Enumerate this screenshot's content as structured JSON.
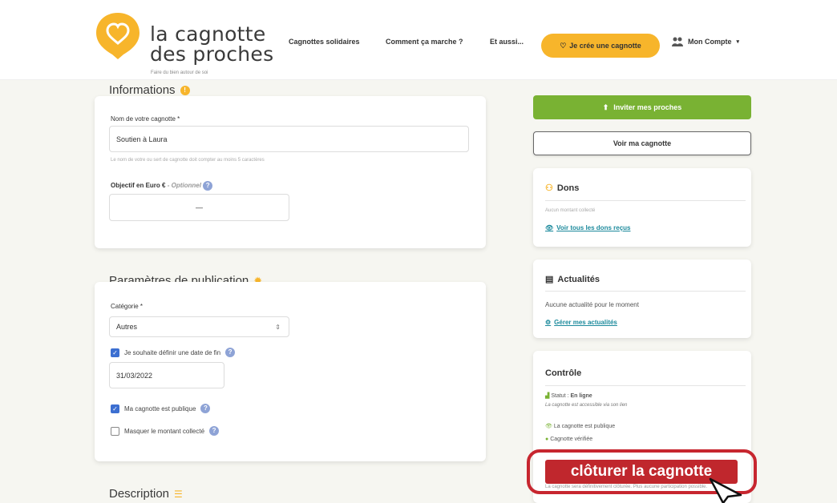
{
  "header": {
    "logo_title": "la cagnotte\ndes proches",
    "logo_tagline": "Faire du bien autour de soi",
    "nav": [
      "Cagnottes solidaires",
      "Comment ça marche ?",
      "Et aussi..."
    ],
    "cta_label": "Je crée une cagnotte",
    "account_label": "Mon Compte"
  },
  "informations": {
    "title": "Informations",
    "name_label": "Nom de votre cagnotte *",
    "name_value": "Soutien à Laura",
    "name_hint": "Le nom de votre ou sert de cagnotte doit compter au moins 5 caractères",
    "goal_label": "Objectif en Euro €",
    "goal_optional": "- Optionnel",
    "goal_value": "—"
  },
  "publication": {
    "title": "Paramètres de publication",
    "category_label": "Catégorie *",
    "category_value": "Autres",
    "end_date_label": "Je souhaite définir une date de fin",
    "end_date_value": "31/03/2022",
    "public_label": "Ma cagnotte est publique",
    "hide_amount_label": "Masquer le montant collecté"
  },
  "description": {
    "title": "Description"
  },
  "sidebar": {
    "invite_label": "Inviter mes proches",
    "view_label": "Voir ma cagnotte",
    "dons_title": "Dons",
    "dons_empty": "Aucun montant collecté",
    "dons_link": "Voir tous les dons reçus",
    "news_title": "Actualités",
    "news_empty": "Aucune actualité pour le moment",
    "news_link": "Gérer mes actualités",
    "control_title": "Contrôle",
    "status_label": "Statut : ",
    "status_value": "En ligne",
    "status_sub": "La cagnotte est accessible via son lien",
    "public_status": "La cagnotte est publique",
    "verified_status": "Cagnotte vérifiée",
    "close_label": "clôturer la cagnotte",
    "close_note": "La cagnotte sera définitivement clôturée. Plus aucune participation possible."
  },
  "colors": {
    "brand_yellow": "#f7b52b",
    "green": "#79b233",
    "red": "#c0272d",
    "link": "#1c8a9c"
  },
  "icons": [
    "heart-logo-icon",
    "heart-icon",
    "account-icon",
    "info-icon",
    "gear-icon",
    "invite-icon",
    "dons-icon",
    "eye-icon",
    "newspaper-icon",
    "settings-icon",
    "status-icon",
    "public-icon",
    "verified-icon",
    "question-icon",
    "cursor-icon"
  ]
}
